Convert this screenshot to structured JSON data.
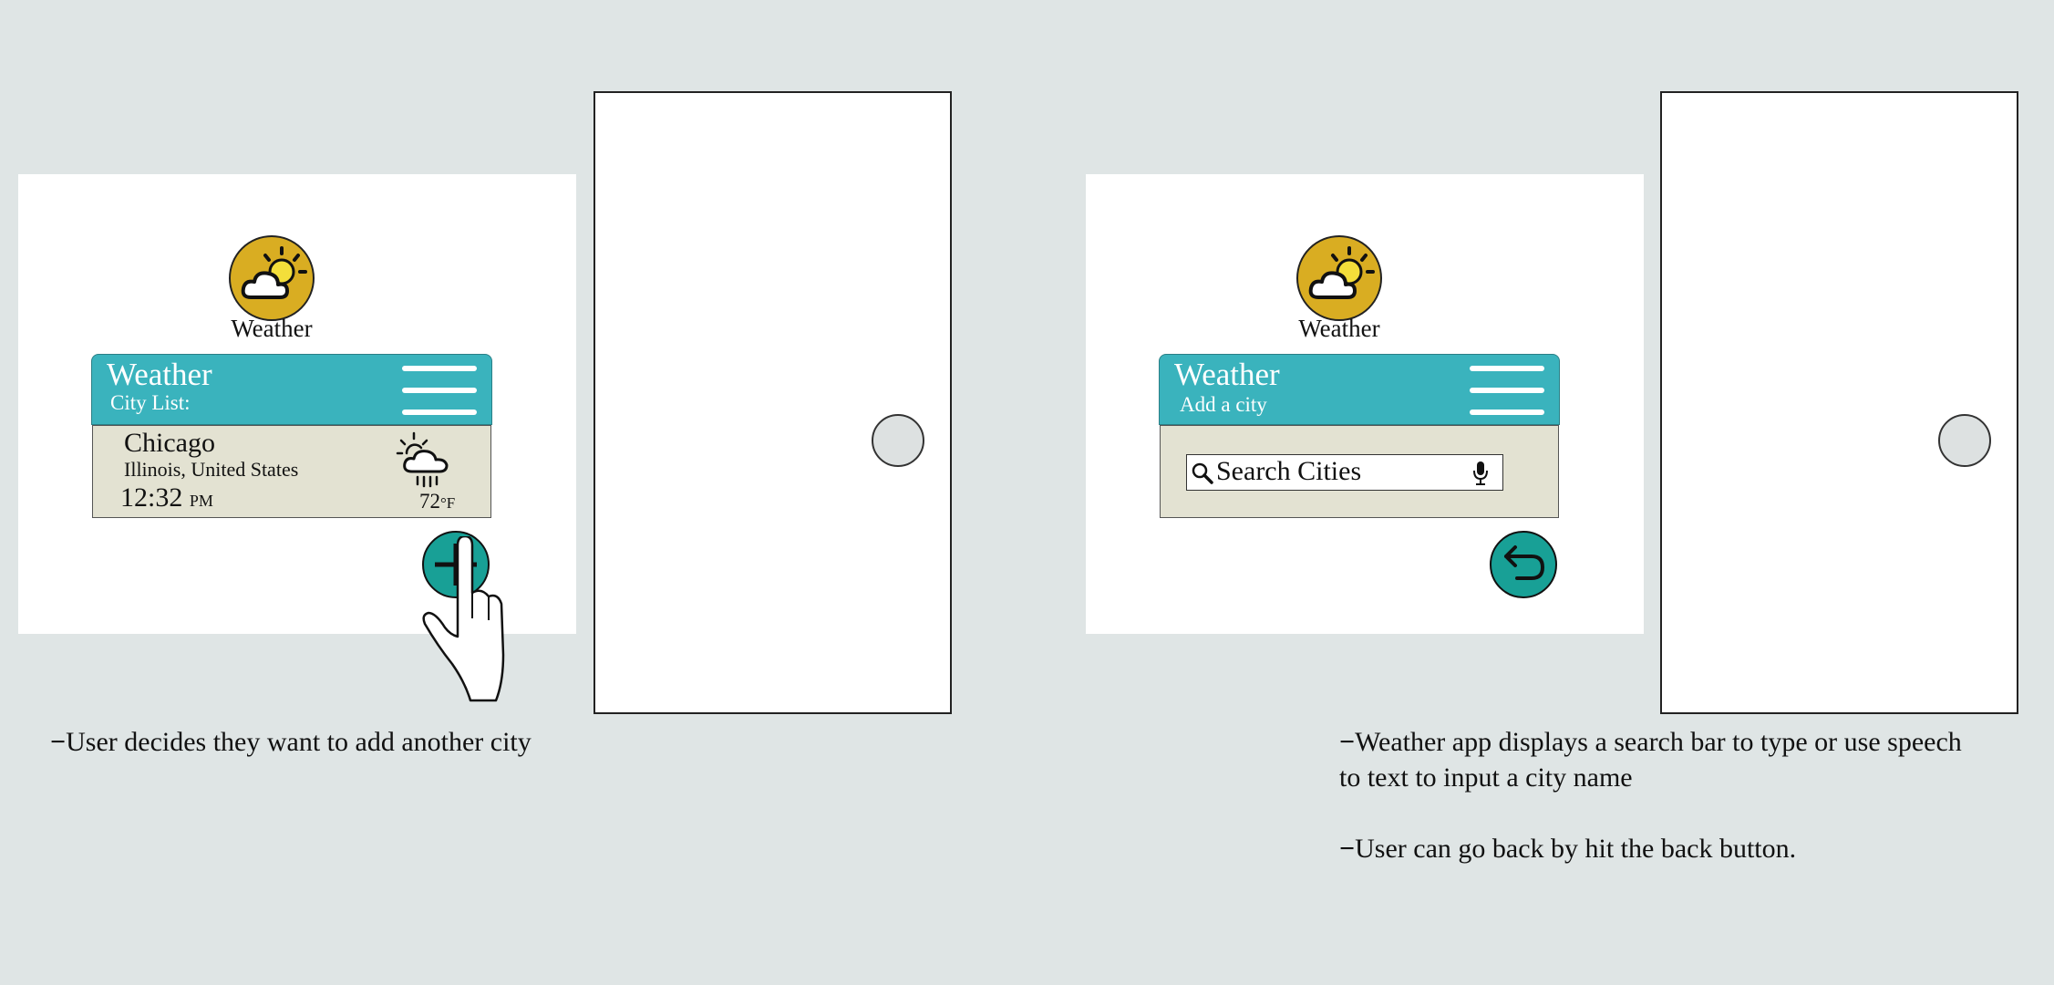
{
  "left_panel": {
    "app_label": "Weather",
    "header": {
      "title": "Weather",
      "subtitle": "City List:"
    },
    "city": {
      "name": "Chicago",
      "region": "Illinois, United States",
      "time": "12:32",
      "ampm": "PM",
      "temp": "72",
      "unit": "°F",
      "weather_icon": "cloud-rain-sun-icon"
    },
    "fab_icon": "plus-icon",
    "pointer_icon": "hand-pointer-icon",
    "caption": "User decides they want to add another city"
  },
  "right_panel": {
    "app_label": "Weather",
    "header": {
      "title": "Weather",
      "subtitle": "Add a city"
    },
    "search": {
      "placeholder": "Search Cities",
      "search_icon": "search-icon",
      "mic_icon": "microphone-icon"
    },
    "fab_icon": "back-arrow-icon",
    "caption_1": "Weather app displays a search bar to type or use speech to text to input a city name",
    "caption_2": "User can go back by hit the back button."
  },
  "colors": {
    "background": "#dfe5e5",
    "header": "#3ab3bd",
    "card": "#e3e2d2",
    "fab": "#18a096",
    "app_icon": "#d9ad22"
  }
}
